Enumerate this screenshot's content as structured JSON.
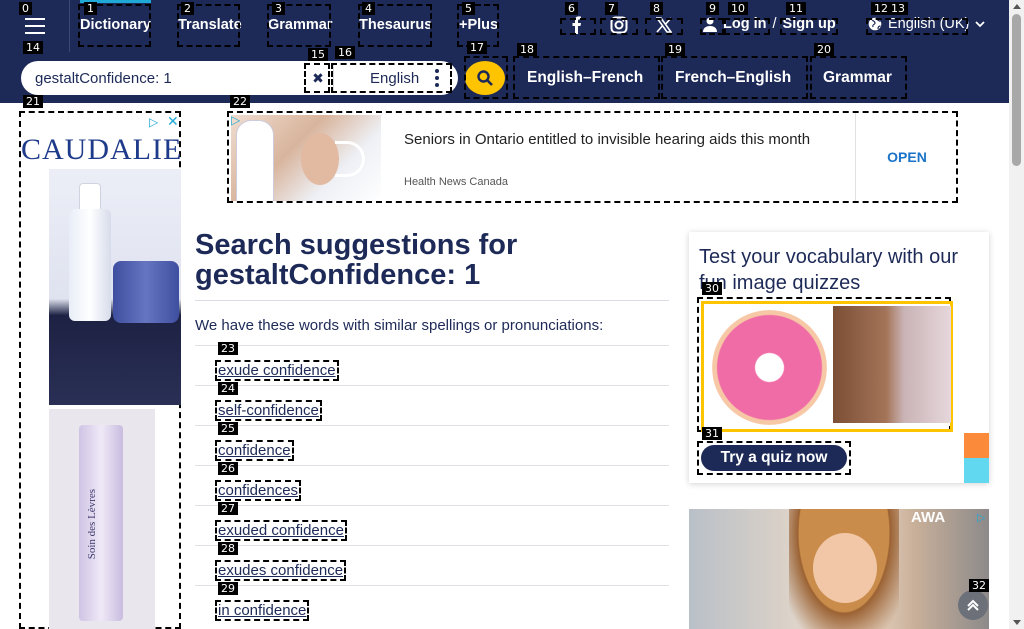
{
  "header": {
    "nav": [
      {
        "label": "Dictionary"
      },
      {
        "label": "Translate"
      },
      {
        "label": "Grammar"
      },
      {
        "label": "Thesaurus"
      },
      {
        "label": "+Plus"
      }
    ],
    "login_label": "Log in",
    "login_sep": "/",
    "signup_label": "Sign up",
    "language_label": "English (UK)",
    "social": [
      "facebook-icon",
      "instagram-icon",
      "x-icon"
    ]
  },
  "search": {
    "value": "gestaltConfidence: 1",
    "dictionary_label": "English",
    "links": [
      {
        "label": "English–French"
      },
      {
        "label": "French–English"
      },
      {
        "label": "Grammar"
      }
    ]
  },
  "ads": {
    "side_brand": "CAUDALIE",
    "side_product_text": "Soin des Lèvres",
    "top_title": "Seniors in Ontario entitled to invisible hearing aids this month",
    "top_source": "Health News Canada",
    "top_open": "OPEN",
    "bottom_text": "AWA"
  },
  "main": {
    "heading": "Search suggestions for",
    "heading_term": "gestaltConfidence: 1",
    "intro": "We have these words with similar spellings or pronunciations:",
    "suggestions": [
      "exude confidence",
      "self-confidence",
      "confidence",
      "confidences",
      "exuded confidence",
      "exudes confidence",
      "in confidence"
    ]
  },
  "quiz": {
    "title": "Test your vocabulary with our fun image quizzes",
    "button": "Try a quiz now"
  },
  "tags": [
    "0",
    "1",
    "2",
    "3",
    "4",
    "5",
    "6",
    "7",
    "8",
    "9",
    "10",
    "11",
    "12",
    "13",
    "14",
    "15",
    "16",
    "17",
    "18",
    "19",
    "20",
    "21",
    "22",
    "23",
    "24",
    "25",
    "26",
    "27",
    "28",
    "29",
    "30",
    "31",
    "32"
  ],
  "colors": {
    "navy": "#1d2a57",
    "yellow": "#fec400",
    "accent": "#1ea9d6"
  }
}
